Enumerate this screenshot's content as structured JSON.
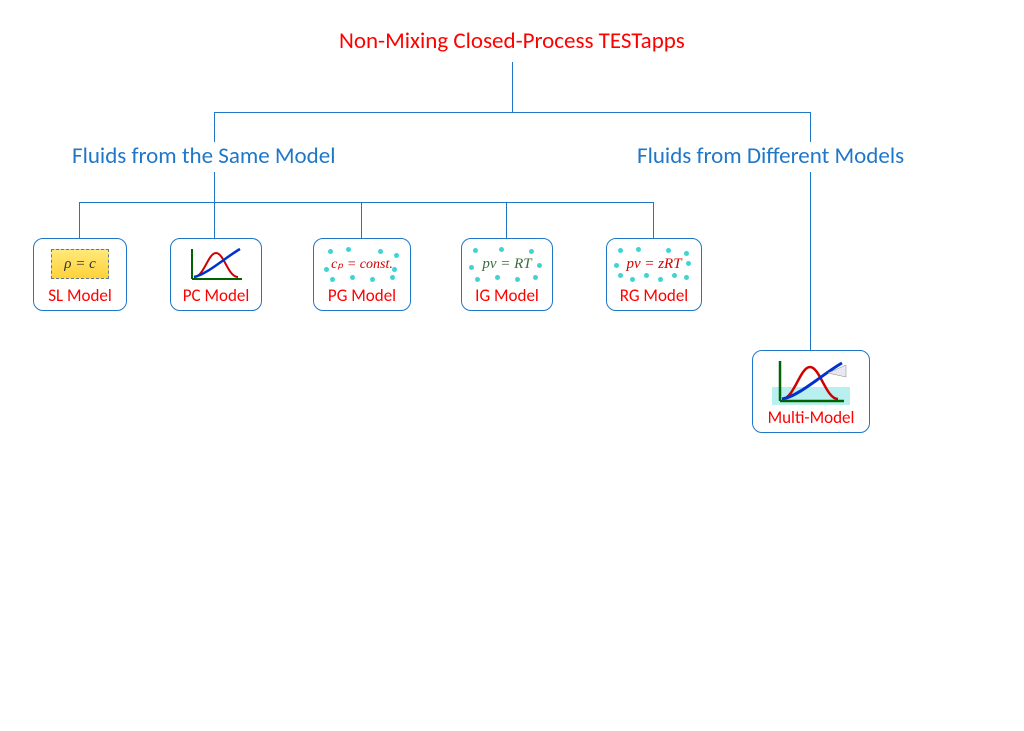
{
  "title": "Non-Mixing Closed-Process TESTapps",
  "branches": {
    "left": {
      "label": "Fluids from the Same Model"
    },
    "right": {
      "label": "Fluids from Different Models"
    }
  },
  "models": {
    "sl": {
      "label": "SL Model",
      "equation": "ρ = c"
    },
    "pc": {
      "label": "PC Model"
    },
    "pg": {
      "label": "PG Model",
      "equation": "cₚ = const."
    },
    "ig": {
      "label": "IG Model",
      "equation": "pv = RT"
    },
    "rg": {
      "label": "RG Model",
      "equation": "pv = zRT"
    },
    "multi": {
      "label": "Multi-Model"
    }
  }
}
